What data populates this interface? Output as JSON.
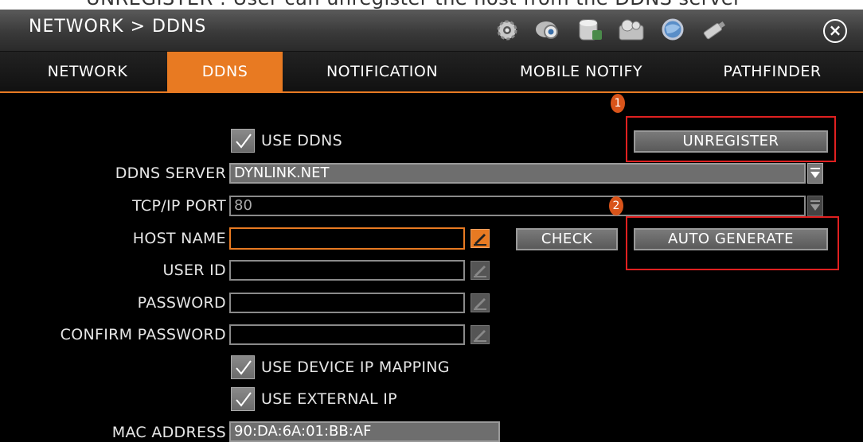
{
  "caption": "UNREGISTER : User can unregister the host from the DDNS server",
  "window": {
    "title": "NETWORK > DDNS"
  },
  "toolbar_icons": [
    "system-gear-icon",
    "video-camera-icon",
    "storage-disk-icon",
    "record-reel-icon",
    "network-globe-icon",
    "usb-drive-icon"
  ],
  "tabs": [
    {
      "label": "NETWORK"
    },
    {
      "label": "DDNS"
    },
    {
      "label": "NOTIFICATION"
    },
    {
      "label": "MOBILE NOTIFY"
    },
    {
      "label": "PATHFINDER"
    }
  ],
  "form": {
    "use_ddns_label": "USE DDNS",
    "use_ddns_checked": true,
    "unregister_label": "UNREGISTER",
    "ddns_server_label": "DDNS SERVER",
    "ddns_server_value": "DYNLINK.NET",
    "tcp_port_label": "TCP/IP PORT",
    "tcp_port_value": "80",
    "host_name_label": "HOST NAME",
    "host_name_value": "",
    "check_label": "CHECK",
    "auto_generate_label": "AUTO GENERATE",
    "user_id_label": "USER ID",
    "user_id_value": "",
    "password_label": "PASSWORD",
    "password_value": "",
    "confirm_password_label": "CONFIRM PASSWORD",
    "confirm_password_value": "",
    "use_device_ip_label": "USE DEVICE IP MAPPING",
    "use_device_ip_checked": true,
    "use_external_ip_label": "USE EXTERNAL IP",
    "use_external_ip_checked": true,
    "mac_address_label": "MAC ADDRESS",
    "mac_address_value": "90:DA:6A:01:BB:AF"
  },
  "annotations": [
    {
      "number": "1"
    },
    {
      "number": "2"
    }
  ],
  "colors": {
    "accent": "#e87a22",
    "highlight": "#e02020"
  }
}
